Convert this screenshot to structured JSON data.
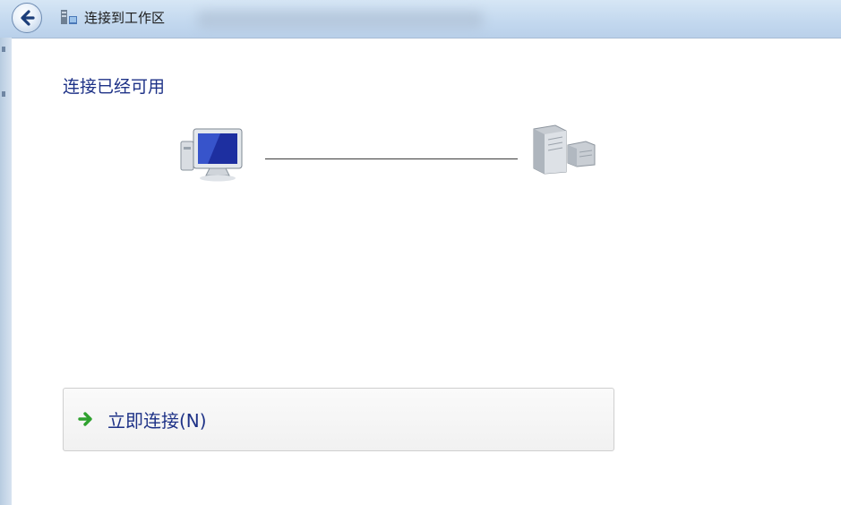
{
  "window": {
    "title": "连接到工作区",
    "back_icon": "back-arrow-icon",
    "title_icon": "workplace-connection-icon"
  },
  "main": {
    "heading": "连接已经可用",
    "diagram": {
      "left_icon": "computer-icon",
      "right_icon": "server-icon",
      "status": "connected"
    },
    "options": [
      {
        "label": "立即连接(N)",
        "icon": "green-arrow-icon"
      }
    ]
  },
  "colors": {
    "heading_text": "#1e3287",
    "titlebar": "#c4d9ef",
    "option_border": "#cfcfcf",
    "arrow_green": "#2fa12f"
  }
}
